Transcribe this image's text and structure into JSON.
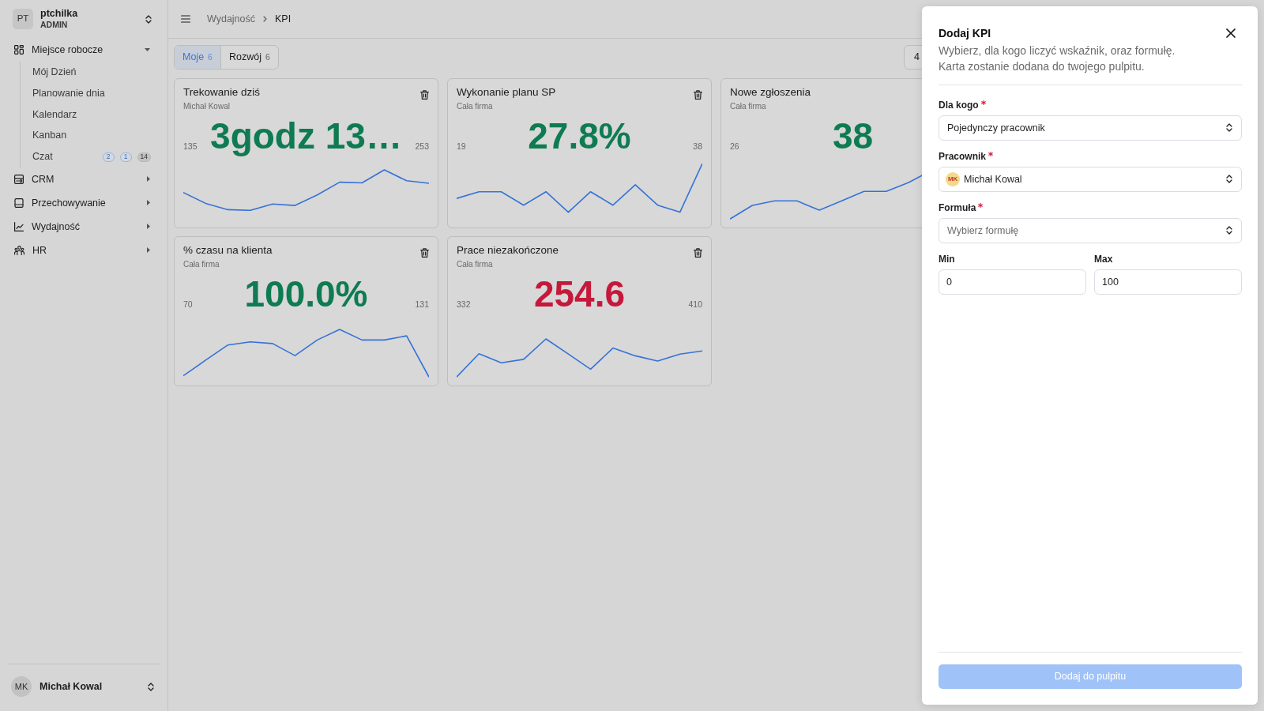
{
  "sidebar": {
    "account": {
      "initials": "PT",
      "name": "ptchilka",
      "role": "ADMIN"
    },
    "items": [
      {
        "label": "Miejsce robocze",
        "expanded": true,
        "children": [
          {
            "label": "Mój Dzień"
          },
          {
            "label": "Planowanie dnia"
          },
          {
            "label": "Kalendarz"
          },
          {
            "label": "Kanban"
          },
          {
            "label": "Czat",
            "badges": [
              {
                "text": "2",
                "kind": "info"
              },
              {
                "text": "1",
                "kind": "info"
              },
              {
                "text": "14",
                "kind": "muted"
              }
            ]
          }
        ]
      },
      {
        "label": "CRM",
        "expanded": false
      },
      {
        "label": "Przechowywanie",
        "expanded": false
      },
      {
        "label": "Wydajność",
        "expanded": false
      },
      {
        "label": "HR",
        "expanded": false
      }
    ],
    "user": {
      "initials": "MK",
      "name": "Michał Kowal"
    }
  },
  "topbar": {
    "breadcrumb": [
      "Wydajność",
      "KPI"
    ]
  },
  "tabs": [
    {
      "label": "Moje",
      "count": "6",
      "selected": true
    },
    {
      "label": "Rozwój",
      "count": "6",
      "selected": false
    }
  ],
  "toolbar_button": {
    "label": "4"
  },
  "card_rows": [
    [
      {
        "title": "Trekowanie dziś",
        "subtitle": "Michał Kowal",
        "value": "3godz 13…",
        "color": "#0f7b52",
        "min": "135",
        "max": "253",
        "removable": true
      },
      {
        "title": "Wykonanie planu SP",
        "subtitle": "Cała firma",
        "value": "27.8%",
        "color": "#0f7b52",
        "min": "19",
        "max": "38",
        "removable": true
      },
      {
        "title": "Nowe zgłoszenia",
        "subtitle": "Cała firma",
        "value": "38",
        "color": "#0f7b52",
        "min": "26"
      }
    ],
    [
      {
        "title": "% czasu na klienta",
        "subtitle": "Cała firma",
        "value": "100.0%",
        "color": "#0f7b52",
        "min": "70",
        "max": "131",
        "removable": true
      },
      {
        "title": "Prace niezakończone",
        "subtitle": "Cała firma",
        "value": "254.6",
        "color": "#c5193b",
        "min": "332",
        "max": "410",
        "removable": true
      }
    ]
  ],
  "panel": {
    "title": "Dodaj KPI",
    "description": "Wybierz, dla kogo liczyć wskaźnik, oraz formułę.\nKarta zostanie dodana do twojego pulpitu.",
    "fields": [
      {
        "label": "Dla kogo",
        "required": true,
        "value": "Pojedynczy pracownik"
      },
      {
        "label": "Pracownik",
        "required": true,
        "value": "Michał Kowal",
        "avatar": "MK"
      },
      {
        "label": "Formuła",
        "required": true,
        "placeholder": "Wybierz formułę"
      }
    ],
    "range_fields": [
      {
        "label": "Min",
        "value": "0"
      },
      {
        "label": "Max",
        "value": "100"
      }
    ],
    "submit": {
      "label": "Dodaj do pulpitu",
      "disabled": true
    }
  }
}
